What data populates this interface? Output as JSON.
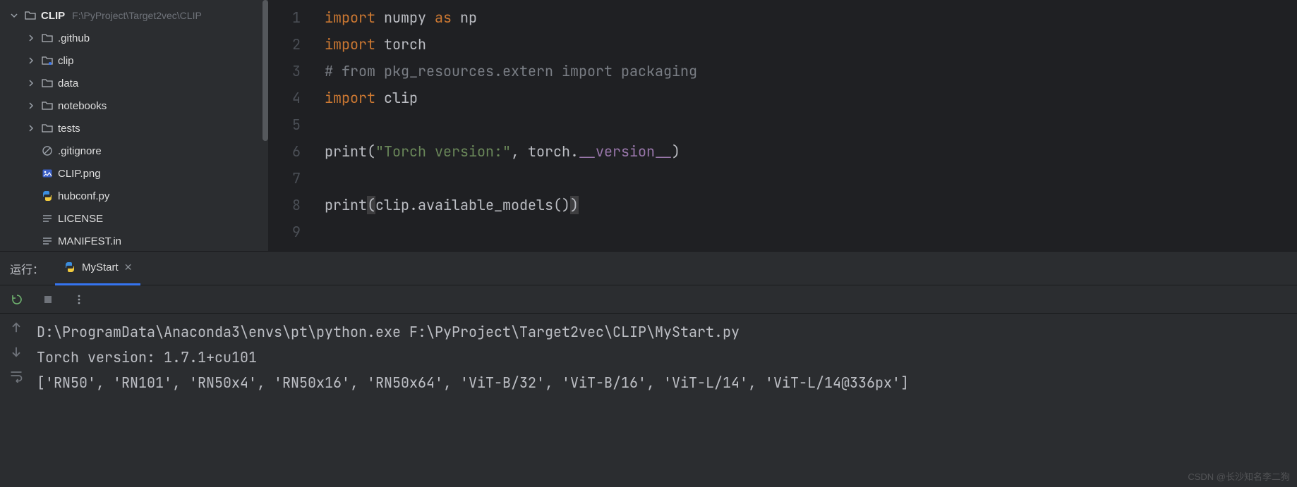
{
  "sidebar": {
    "root_name": "CLIP",
    "root_path": "F:\\PyProject\\Target2vec\\CLIP",
    "items": [
      {
        "name": ".github",
        "type": "folder",
        "expandable": true
      },
      {
        "name": "clip",
        "type": "folder-src",
        "expandable": true
      },
      {
        "name": "data",
        "type": "folder",
        "expandable": true
      },
      {
        "name": "notebooks",
        "type": "folder",
        "expandable": true
      },
      {
        "name": "tests",
        "type": "folder",
        "expandable": true
      },
      {
        "name": ".gitignore",
        "type": "ignore",
        "expandable": false
      },
      {
        "name": "CLIP.png",
        "type": "image",
        "expandable": false
      },
      {
        "name": "hubconf.py",
        "type": "python",
        "expandable": false
      },
      {
        "name": "LICENSE",
        "type": "text",
        "expandable": false
      },
      {
        "name": "MANIFEST.in",
        "type": "text",
        "expandable": false
      }
    ]
  },
  "editor": {
    "lines": [
      {
        "num": "1",
        "tokens": [
          {
            "t": "import ",
            "c": "kw"
          },
          {
            "t": "numpy",
            "c": "ident-underline"
          },
          {
            "t": " ",
            "c": ""
          },
          {
            "t": "as",
            "c": "kw"
          },
          {
            "t": " np",
            "c": ""
          }
        ]
      },
      {
        "num": "2",
        "tokens": [
          {
            "t": "import ",
            "c": "kw"
          },
          {
            "t": "torch",
            "c": ""
          }
        ]
      },
      {
        "num": "3",
        "tokens": [
          {
            "t": "# from pkg_resources.extern import packaging",
            "c": "comment"
          }
        ]
      },
      {
        "num": "4",
        "tokens": [
          {
            "t": "import ",
            "c": "kw"
          },
          {
            "t": "clip",
            "c": ""
          }
        ]
      },
      {
        "num": "5",
        "tokens": [
          {
            "t": "",
            "c": ""
          }
        ]
      },
      {
        "num": "6",
        "tokens": [
          {
            "t": "print",
            "c": ""
          },
          {
            "t": "(",
            "c": "punc"
          },
          {
            "t": "\"Torch version:\"",
            "c": "str"
          },
          {
            "t": ", torch.",
            "c": ""
          },
          {
            "t": "__version__",
            "c": "attr"
          },
          {
            "t": ")",
            "c": "punc"
          }
        ]
      },
      {
        "num": "7",
        "tokens": [
          {
            "t": "",
            "c": ""
          }
        ]
      },
      {
        "num": "8",
        "tokens": [
          {
            "t": "print",
            "c": ""
          },
          {
            "t": "(",
            "c": "hl-paren"
          },
          {
            "t": "clip.available_models()",
            "c": ""
          },
          {
            "t": ")",
            "c": "hl-paren"
          }
        ]
      },
      {
        "num": "9",
        "tokens": [
          {
            "t": "",
            "c": ""
          }
        ]
      }
    ]
  },
  "bottom": {
    "run_label": "运行：",
    "tab_name": "MyStart",
    "console_lines": [
      "D:\\ProgramData\\Anaconda3\\envs\\pt\\python.exe F:\\PyProject\\Target2vec\\CLIP\\MyStart.py",
      "Torch version: 1.7.1+cu101",
      "['RN50', 'RN101', 'RN50x4', 'RN50x16', 'RN50x64', 'ViT-B/32', 'ViT-B/16', 'ViT-L/14', 'ViT-L/14@336px']"
    ]
  },
  "watermark": "CSDN @长沙知名李二狗"
}
